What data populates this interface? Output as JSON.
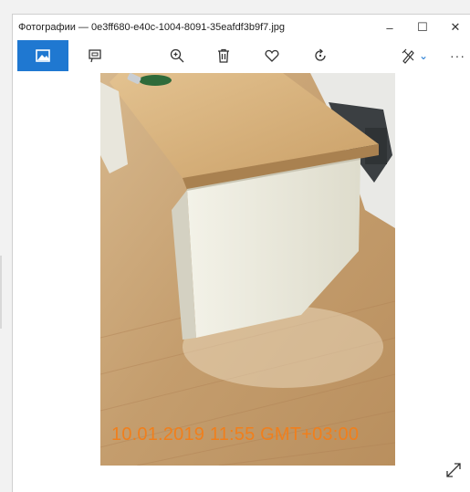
{
  "window": {
    "title": "Фотографии — 0e3ff680-e40c-1004-8091-35eafdf3b9f7.jpg",
    "controls": {
      "minimize": "–",
      "maximize": "☐",
      "close": "✕"
    }
  },
  "toolbar": {
    "items": [
      {
        "name": "view-photo-icon",
        "active": true
      },
      {
        "name": "slideshow-icon"
      },
      {
        "name": "zoom-in-icon"
      },
      {
        "name": "delete-icon"
      },
      {
        "name": "favorite-icon"
      },
      {
        "name": "rotate-icon"
      },
      {
        "name": "edit-draw-icon"
      },
      {
        "name": "more-icon"
      }
    ],
    "more_label": "···",
    "edit_chevron": "⌄"
  },
  "photo": {
    "timestamp": "10.01.2019 11:55 GMT+03:00"
  },
  "colors": {
    "accent": "#1f78d1",
    "timestamp": "#f07f1c",
    "floor": "#c9a77c",
    "desk_top": "#d9b47e",
    "desk_body": "#efeee4"
  }
}
